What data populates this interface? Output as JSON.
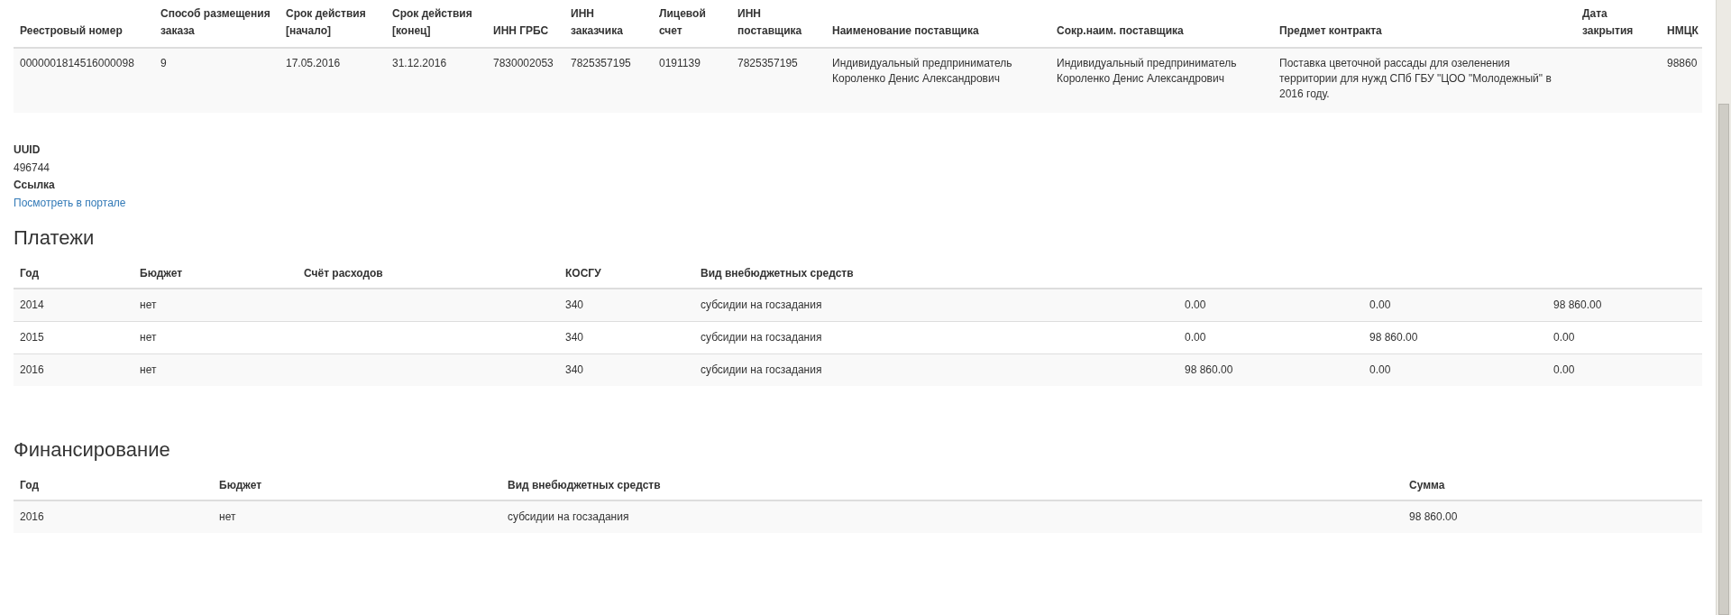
{
  "contract_table": {
    "columns": [
      "Реестровый номер",
      "Способ размещения заказа",
      "Срок действия [начало]",
      "Срок действия [конец]",
      "ИНН ГРБС",
      "ИНН заказчика",
      "Лицевой счет",
      "ИНН поставщика",
      "Наименование поставщика",
      "Сокр.наим. поставщика",
      "Предмет контракта",
      "Дата закрытия",
      "НМЦК"
    ],
    "rows": [
      [
        "0000001814516000098",
        "9",
        "17.05.2016",
        "31.12.2016",
        "7830002053",
        "7825357195",
        "0191139",
        "7825357195",
        "Индивидуальный предприниматель Короленко Денис Александрович",
        "Индивидуальный предприниматель Короленко Денис Александрович",
        "Поставка цветочной рассады для озеленения территории для нужд СПб ГБУ \"ЦОО \"Молодежный\" в 2016 году.",
        null,
        "98860"
      ]
    ]
  },
  "details": [
    {
      "label": "UUID",
      "value": "496744",
      "kind": "text"
    },
    {
      "label": "Ссылка",
      "value": "Посмотреть в портале",
      "kind": "link"
    }
  ],
  "payments": {
    "title": "Платежи",
    "columns": [
      "Год",
      "Бюджет",
      "Счёт расходов",
      "КОСГУ",
      "Вид внебюджетных средств",
      null,
      null,
      null
    ],
    "rows": [
      [
        "2014",
        "нет",
        null,
        "340",
        "субсидии на госзадания",
        "0.00",
        "0.00",
        "98 860.00"
      ],
      [
        "2015",
        "нет",
        null,
        "340",
        "субсидии на госзадания",
        "0.00",
        "98 860.00",
        "0.00"
      ],
      [
        "2016",
        "нет",
        null,
        "340",
        "субсидии на госзадания",
        "98 860.00",
        "0.00",
        "0.00"
      ]
    ]
  },
  "financing": {
    "title": "Финансирование",
    "columns": [
      "Год",
      "Бюджет",
      "Вид внебюджетных средств",
      "Сумма"
    ],
    "rows": [
      [
        "2016",
        "нет",
        "субсидии на госзадания",
        "98 860.00"
      ]
    ]
  }
}
